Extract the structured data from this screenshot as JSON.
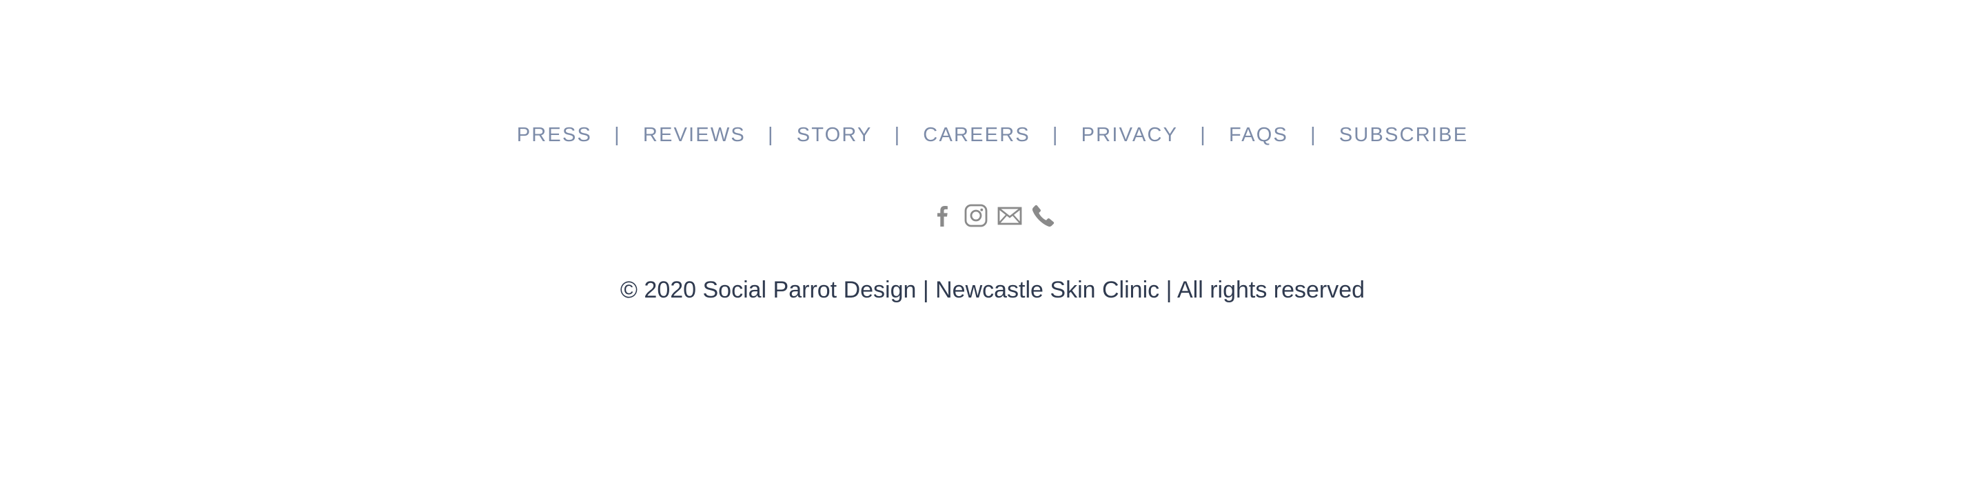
{
  "footer": {
    "nav": {
      "separator": "|",
      "items": [
        {
          "label": "PRESS"
        },
        {
          "label": "REVIEWS"
        },
        {
          "label": "STORY"
        },
        {
          "label": "CAREERS"
        },
        {
          "label": "PRIVACY"
        },
        {
          "label": "FAQS"
        },
        {
          "label": "SUBSCRIBE"
        }
      ]
    },
    "social": [
      {
        "icon": "facebook-icon"
      },
      {
        "icon": "instagram-icon"
      },
      {
        "icon": "email-icon"
      },
      {
        "icon": "phone-icon"
      }
    ],
    "copyright": "© 2020 Social Parrot Design | Newcastle Skin Clinic | All rights reserved"
  },
  "colors": {
    "nav_link": "#7c8ba8",
    "icon": "#8a8a8a",
    "copyright_text": "#2f3a4f",
    "background": "#ffffff"
  }
}
